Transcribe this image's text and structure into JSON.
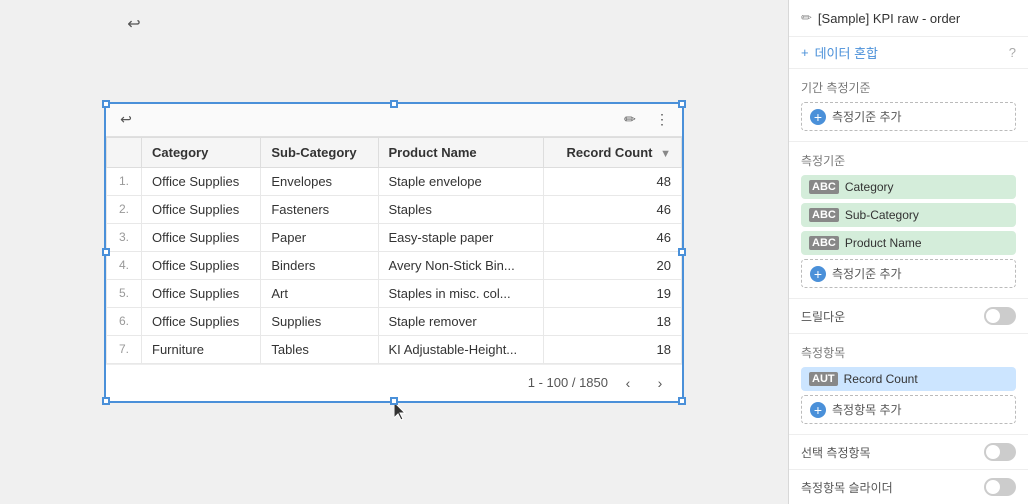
{
  "canvas": {
    "undo_icon": "↩"
  },
  "toolbar": {
    "edit_icon": "✏",
    "more_icon": "⋮"
  },
  "table": {
    "columns": [
      {
        "key": "num",
        "label": ""
      },
      {
        "key": "category",
        "label": "Category"
      },
      {
        "key": "subcategory",
        "label": "Sub-Category"
      },
      {
        "key": "product",
        "label": "Product Name"
      },
      {
        "key": "count",
        "label": "Record Count"
      }
    ],
    "rows": [
      {
        "num": "1.",
        "category": "Office Supplies",
        "subcategory": "Envelopes",
        "product": "Staple envelope",
        "count": "48"
      },
      {
        "num": "2.",
        "category": "Office Supplies",
        "subcategory": "Fasteners",
        "product": "Staples",
        "count": "46"
      },
      {
        "num": "3.",
        "category": "Office Supplies",
        "subcategory": "Paper",
        "product": "Easy-staple paper",
        "count": "46"
      },
      {
        "num": "4.",
        "category": "Office Supplies",
        "subcategory": "Binders",
        "product": "Avery Non-Stick Bin...",
        "count": "20"
      },
      {
        "num": "5.",
        "category": "Office Supplies",
        "subcategory": "Art",
        "product": "Staples in misc. col...",
        "count": "19"
      },
      {
        "num": "6.",
        "category": "Office Supplies",
        "subcategory": "Supplies",
        "product": "Staple remover",
        "count": "18"
      },
      {
        "num": "7.",
        "category": "Furniture",
        "subcategory": "Tables",
        "product": "KI Adjustable-Height...",
        "count": "18"
      }
    ],
    "pagination": "1 - 100 / 1850",
    "prev_icon": "‹",
    "next_icon": "›"
  },
  "right_panel": {
    "dataset_title": "[Sample] KPI raw - order",
    "data_mix_label": "데이터 혼합",
    "period_section_title": "기간 측정기준",
    "add_period_label": "측정기준 추가",
    "dimension_section_title": "측정기준",
    "chips": [
      {
        "label_type": "ABC",
        "name": "Category"
      },
      {
        "label_type": "ABC",
        "name": "Sub-Category"
      },
      {
        "label_type": "ABC",
        "name": "Product Name"
      }
    ],
    "add_dimension_label": "측정기준 추가",
    "drill_down_label": "드릴다운",
    "measure_section_title": "측정항목",
    "measure_chip": {
      "label_type": "AUT",
      "name": "Record Count"
    },
    "add_measure_label": "측정항목 추가",
    "selected_measure_label": "선택 측정항목",
    "measure_slider_label": "측정항목 슬라이더",
    "question_icon": "?"
  }
}
